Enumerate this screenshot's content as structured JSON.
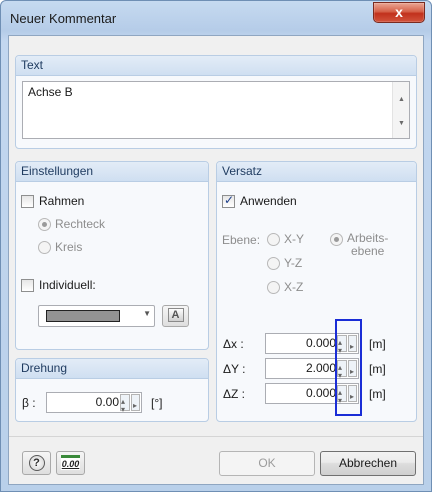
{
  "window": {
    "title": "Neuer Kommentar",
    "close_glyph": "x"
  },
  "text_group": {
    "header": "Text",
    "value": "Achse B"
  },
  "einstellungen": {
    "header": "Einstellungen",
    "rahmen_label": "Rahmen",
    "rahmen_checked": false,
    "rechteck_label": "Rechteck",
    "kreis_label": "Kreis",
    "individuell_label": "Individuell:",
    "individuell_checked": false,
    "color_swatch": "#939393"
  },
  "drehung": {
    "header": "Drehung",
    "beta_label": "β :",
    "beta_value": "0.00",
    "unit": "[°]"
  },
  "versatz": {
    "header": "Versatz",
    "anwenden_label": "Anwenden",
    "anwenden_checked": true,
    "ebene_label": "Ebene:",
    "xy_label": "X-Y",
    "yz_label": "Y-Z",
    "xz_label": "X-Z",
    "arbeitsebene_label_1": "Arbeits-",
    "arbeitsebene_label_2": "ebene",
    "dx_label": "Δx :",
    "dx_value": "0.000",
    "dy_label": "ΔY :",
    "dy_value": "2.000",
    "dz_label": "ΔZ :",
    "dz_value": "0.000",
    "unit": "[m]"
  },
  "buttons": {
    "ok_label": "OK",
    "cancel_label": "Abbrechen",
    "help_icon_text": "?",
    "units_icon_text": "0.00"
  },
  "colors": {
    "title_bar": "#c6daf0",
    "close_button": "#c1311c",
    "highlight": "#1a2dd6"
  }
}
